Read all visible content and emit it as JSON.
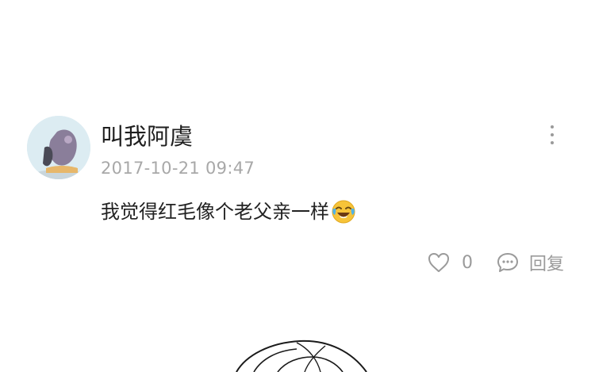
{
  "comment": {
    "username": "叫我阿虞",
    "timestamp": "2017-10-21 09:47",
    "text": "我觉得红毛像个老父亲一样",
    "emoji": "face-with-tears-of-joy",
    "actions": {
      "like_icon": "heart-icon",
      "like_count": "0",
      "reply_icon": "comment-bubble-icon",
      "reply_label": "回复",
      "more_icon": "more-vertical-icon"
    }
  },
  "colors": {
    "text": "#222222",
    "meta": "#a8a8a8",
    "icon": "#9a9a9a",
    "background": "#ffffff",
    "emoji": "#f7c439"
  }
}
